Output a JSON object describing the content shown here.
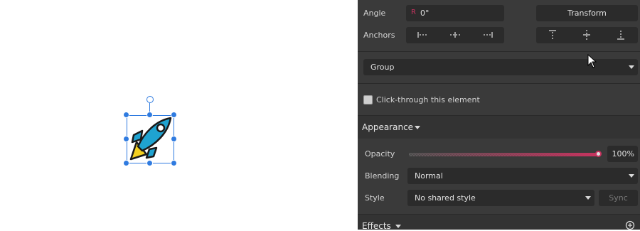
{
  "properties": {
    "angle_label": "Angle",
    "angle_prefix": "R",
    "angle_value": "0°",
    "transform_label": "Transform",
    "anchors_label": "Anchors",
    "group_value": "Group",
    "click_through_label": "Click-through this element"
  },
  "appearance": {
    "title": "Appearance",
    "opacity_label": "Opacity",
    "opacity_value": "100%",
    "opacity_level": 1.0,
    "blending_label": "Blending",
    "blending_value": "Normal",
    "style_label": "Style",
    "style_value": "No shared style",
    "sync_label": "Sync"
  },
  "effects": {
    "title": "Effects"
  },
  "colors": {
    "accent": "#c7335f",
    "selection": "#2f7be0",
    "rocket_body": "#1fa3d1",
    "rocket_flame": "#f3cf1e"
  }
}
